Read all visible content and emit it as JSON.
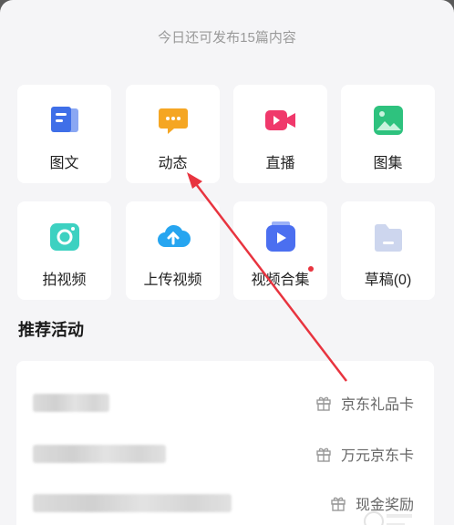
{
  "header": {
    "quota_text": "今日还可发布15篇内容"
  },
  "grid": [
    {
      "label": "图文",
      "icon": "article-icon"
    },
    {
      "label": "动态",
      "icon": "chat-bubble-icon"
    },
    {
      "label": "直播",
      "icon": "live-camera-icon"
    },
    {
      "label": "图集",
      "icon": "gallery-icon"
    },
    {
      "label": "拍视频",
      "icon": "camera-icon"
    },
    {
      "label": "上传视频",
      "icon": "cloud-upload-icon"
    },
    {
      "label": "视频合集",
      "icon": "video-collection-icon",
      "badge": true
    },
    {
      "label": "草稿(0)",
      "icon": "folder-icon"
    }
  ],
  "section": {
    "title": "推荐活动"
  },
  "activities": [
    {
      "reward": "京东礼品卡",
      "icon": "gift-icon"
    },
    {
      "reward": "万元京东卡",
      "icon": "gift-icon"
    },
    {
      "reward": "现金奖励",
      "icon": "gift-icon"
    }
  ],
  "colors": {
    "background": "#f5f5f7",
    "tile": "#ffffff",
    "annotation_arrow": "#e8343f",
    "badge": "#e8343f"
  }
}
